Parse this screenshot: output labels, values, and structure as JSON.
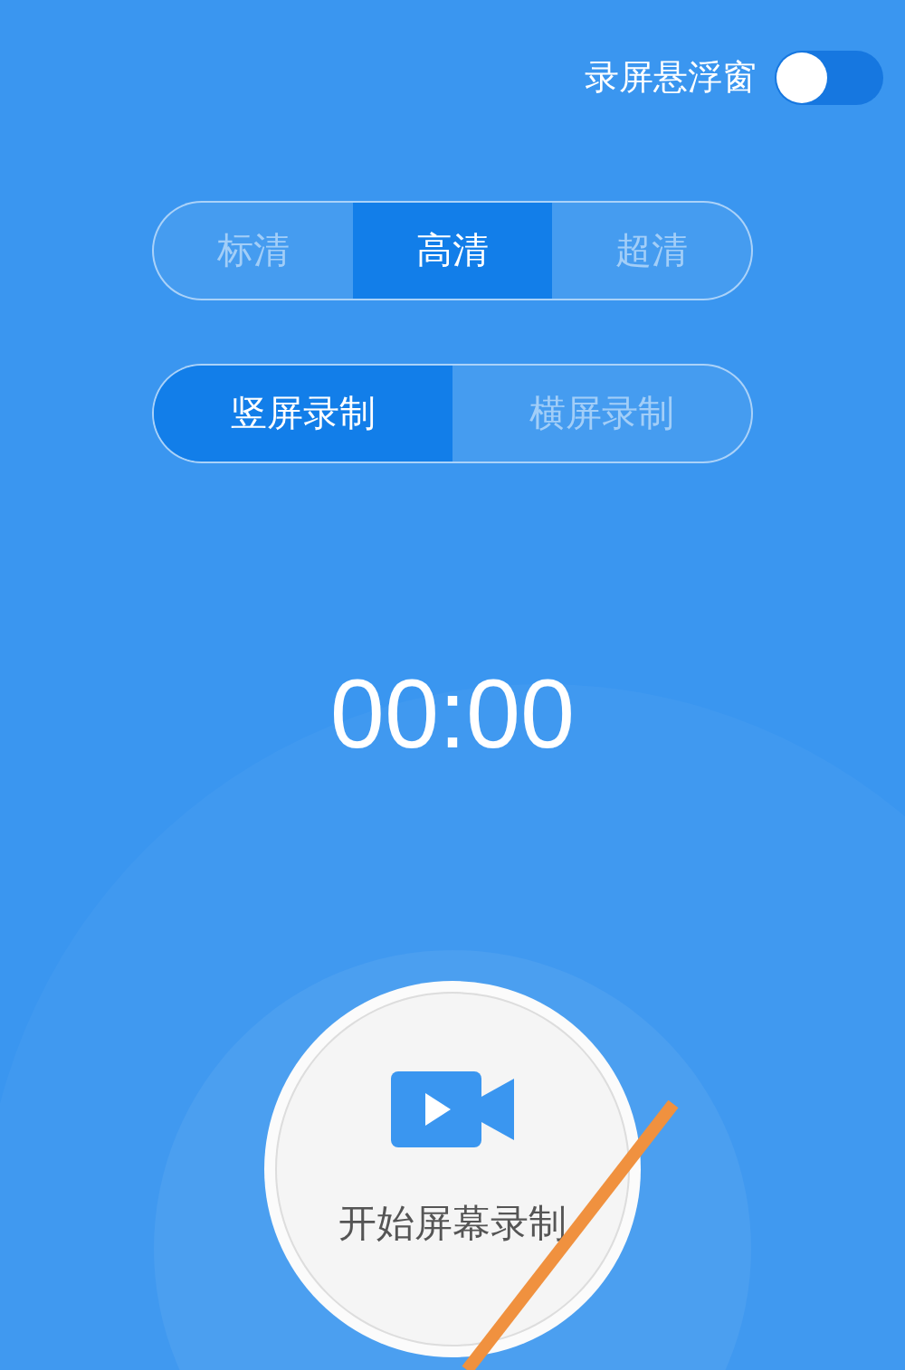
{
  "floating_window_toggle": {
    "label": "录屏悬浮窗",
    "on": false
  },
  "quality_tabs": [
    {
      "label": "标清",
      "selected": false
    },
    {
      "label": "高清",
      "selected": true
    },
    {
      "label": "超清",
      "selected": false
    }
  ],
  "orientation_tabs": [
    {
      "label": "竖屏录制",
      "selected": true
    },
    {
      "label": "横屏录制",
      "selected": false
    }
  ],
  "timer": "00:00",
  "record_button": {
    "label": "开始屏幕录制"
  }
}
